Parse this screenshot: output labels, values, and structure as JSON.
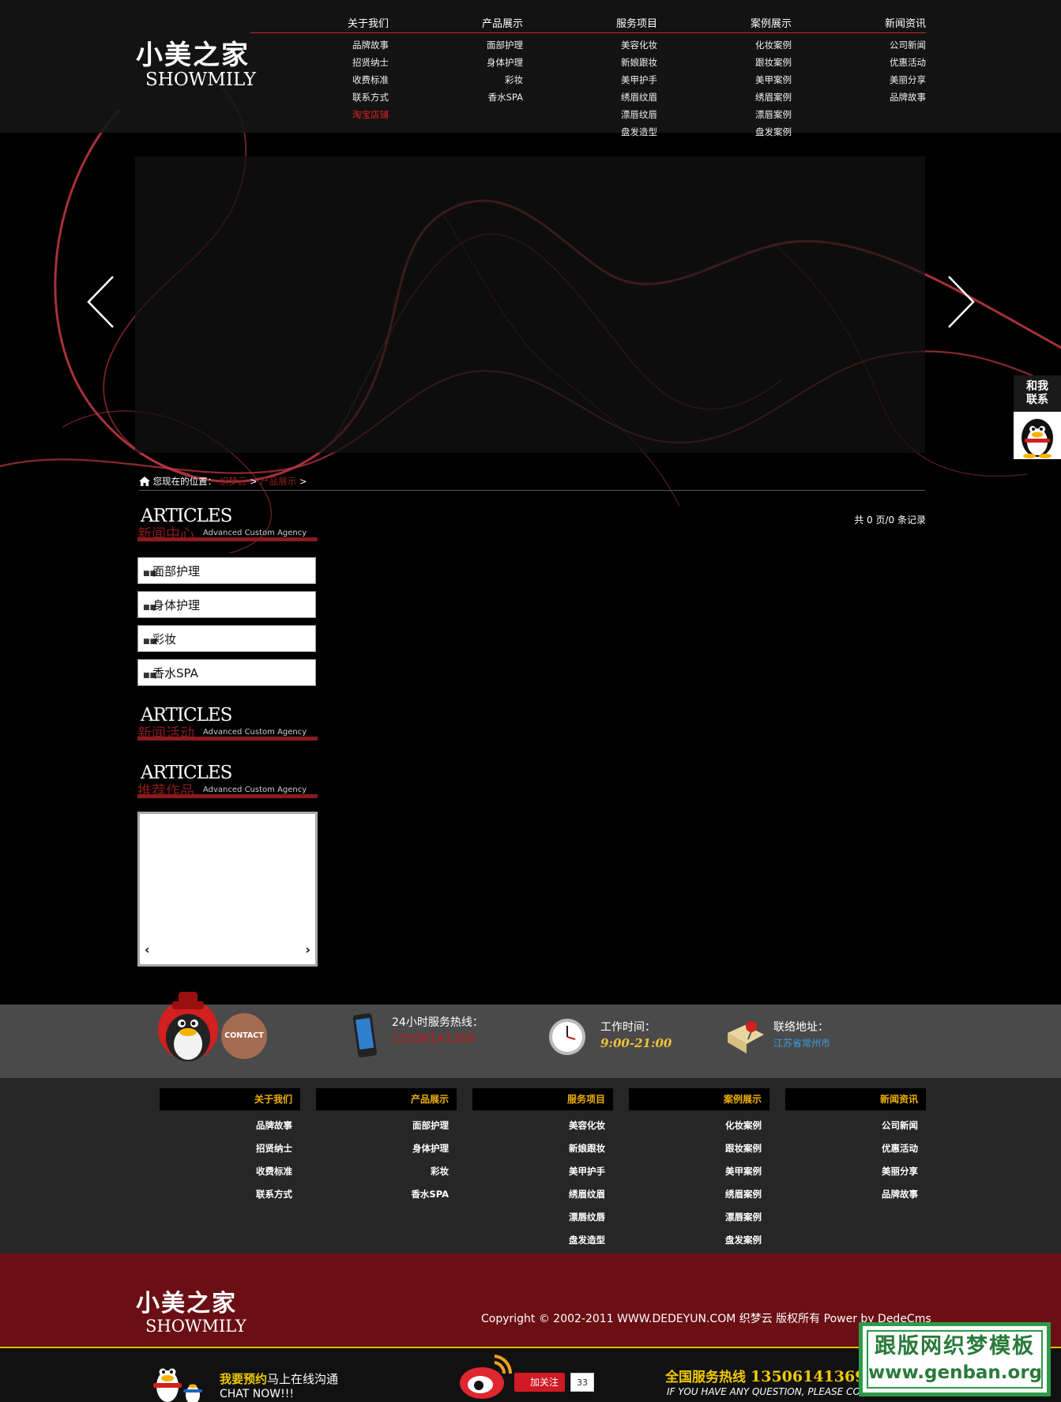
{
  "header": {
    "logo_cn": "小美之家",
    "logo_en": "SHOWMILY",
    "nav": [
      {
        "label": "关于我们",
        "items": [
          "品牌故事",
          "招贤纳士",
          "收费标准",
          "联系方式",
          "淘宝店铺"
        ]
      },
      {
        "label": "产品展示",
        "items": [
          "面部护理",
          "身体护理",
          "彩妆",
          "香水SPA"
        ]
      },
      {
        "label": "服务项目",
        "items": [
          "美容化妆",
          "新娘跟妆",
          "美甲护手",
          "绣眉纹眉",
          "漂唇纹唇",
          "盘发造型"
        ]
      },
      {
        "label": "案例展示",
        "items": [
          "化妆案例",
          "跟妆案例",
          "美甲案例",
          "绣眉案例",
          "漂唇案例",
          "盘发案例"
        ]
      },
      {
        "label": "新闻资讯",
        "items": [
          "公司新闻",
          "优惠活动",
          "美丽分享",
          "品牌故事"
        ]
      }
    ]
  },
  "float_contact": {
    "label_line1": "和我",
    "label_line2": "联系"
  },
  "breadcrumb": {
    "prefix": "您现在的位置：",
    "items": [
      "织梦云",
      "产品展示"
    ],
    "sep": ">"
  },
  "page_count": "共 0 页/0 条记录",
  "sidebar": {
    "sections": [
      {
        "en": "ARTICLES",
        "cn": "新闻中心",
        "sub": "Advanced Custom Agency"
      },
      {
        "en": "ARTICLES",
        "cn": "新闻活动",
        "sub": "Advanced Custom Agency"
      },
      {
        "en": "ARTICLES",
        "cn": "推荐作品",
        "sub": "Advanced Custom Agency"
      }
    ],
    "categories": [
      "面部护理",
      "身体护理",
      "彩妆",
      "香水SPA"
    ],
    "works_prev": "‹",
    "works_next": "›"
  },
  "contact": {
    "contact_btn": "CONTACT",
    "phone_label": "24小时服务热线：",
    "phone_value": "13506141369",
    "time_label": "工作时间：",
    "time_value": "9:00-21:00",
    "addr_label": "联络地址：",
    "addr_value": "江苏省常州市"
  },
  "footer_nav": [
    {
      "label": "关于我们",
      "items": [
        "品牌故事",
        "招贤纳士",
        "收费标准",
        "联系方式"
      ]
    },
    {
      "label": "产品展示",
      "items": [
        "面部护理",
        "身体护理",
        "彩妆",
        "香水SPA"
      ]
    },
    {
      "label": "服务项目",
      "items": [
        "美容化妆",
        "新娘跟妆",
        "美甲护手",
        "绣眉纹眉",
        "漂唇纹唇",
        "盘发造型"
      ]
    },
    {
      "label": "案例展示",
      "items": [
        "化妆案例",
        "跟妆案例",
        "美甲案例",
        "绣眉案例",
        "漂唇案例",
        "盘发案例"
      ]
    },
    {
      "label": "新闻资讯",
      "items": [
        "公司新闻",
        "优惠活动",
        "美丽分享",
        "品牌故事"
      ]
    }
  ],
  "footer": {
    "logo_cn": "小美之家",
    "logo_en": "SHOWMILY",
    "copyright": "Copyright © 2002-2011 WWW.DEDEYUN.COM 织梦云 版权所有 Power by DedeCms"
  },
  "bottom": {
    "chat_yellow": "我要预约",
    "chat_white": "马上在线沟通",
    "chat_sub": "CHAT NOW!!!",
    "follow_label": "加关注",
    "follow_count": "33",
    "hotline_label": "全国服务热线",
    "hotline_number": "13506141369",
    "hotline_sub": "IF YOU HAVE ANY QUESTION, PLEASE CO"
  },
  "watermark": {
    "line1": "跟版网织梦模板",
    "line2": "www.genban.org"
  },
  "colors": {
    "accent_red": "#8b1a1e",
    "footer_red": "#6b0f15",
    "gold": "#f0c800"
  }
}
